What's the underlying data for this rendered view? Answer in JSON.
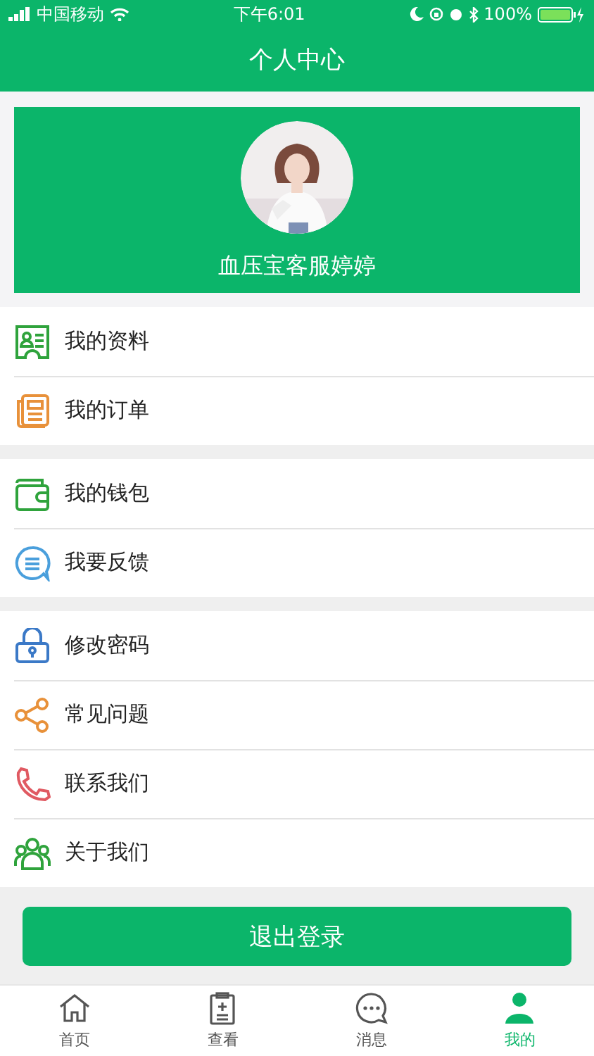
{
  "status_bar": {
    "carrier": "中国移动",
    "time": "下午6:01",
    "battery": "100%"
  },
  "nav": {
    "title": "个人中心"
  },
  "profile": {
    "name": "血压宝客服婷婷"
  },
  "menu_groups": [
    {
      "items": [
        {
          "label": "我的资料"
        },
        {
          "label": "我的订单"
        }
      ]
    },
    {
      "items": [
        {
          "label": "我的钱包"
        },
        {
          "label": "我要反馈"
        }
      ]
    },
    {
      "items": [
        {
          "label": "修改密码"
        },
        {
          "label": "常见问题"
        },
        {
          "label": "联系我们"
        },
        {
          "label": "关于我们"
        }
      ]
    }
  ],
  "logout_button": "退出登录",
  "tab_bar": [
    {
      "label": "首页",
      "selected": false
    },
    {
      "label": "查看",
      "selected": false
    },
    {
      "label": "消息",
      "selected": false
    },
    {
      "label": "我的",
      "selected": true
    }
  ]
}
